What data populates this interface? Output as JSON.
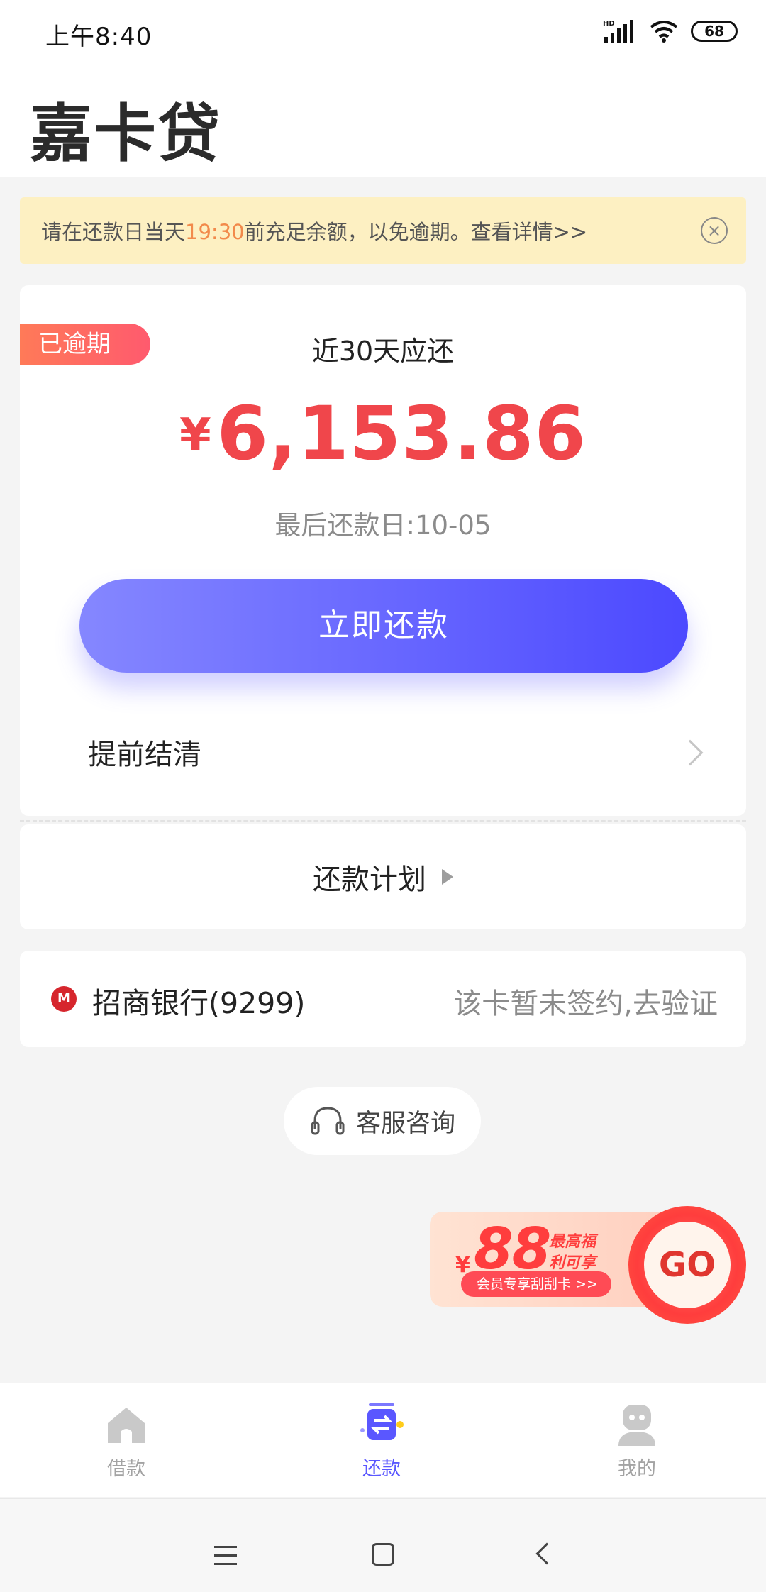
{
  "status_bar": {
    "time": "上午8:40",
    "network": "HD",
    "battery": "68"
  },
  "header": {
    "title": "嘉卡贷"
  },
  "notice": {
    "text_before": "请在还款日当天",
    "time_highlight": "19:30",
    "text_after": "前充足余额，以免逾期。查看详情>>",
    "close_symbol": "×"
  },
  "bill": {
    "badge": "已逾期",
    "label": "近30天应还",
    "currency": "¥",
    "amount": "6,153.86",
    "due_date": "最后还款日:10-05",
    "repay_button": "立即还款",
    "settle_label": "提前结清"
  },
  "plan": {
    "label": "还款计划"
  },
  "bank": {
    "logo_text": "M",
    "name": "招商银行(9299)",
    "status": "该卡暂未签约,去验证"
  },
  "service": {
    "label": "客服咨询"
  },
  "promo": {
    "currency": "¥",
    "amount": "88",
    "side_line1": "最高福",
    "side_line2": "利可享",
    "pill": "会员专享刮刮卡 >>",
    "go": "GO"
  },
  "tabs": [
    {
      "label": "借款",
      "icon": "home-icon",
      "active": false
    },
    {
      "label": "还款",
      "icon": "repay-icon",
      "active": true
    },
    {
      "label": "我的",
      "icon": "profile-icon",
      "active": false
    }
  ],
  "colors": {
    "accent": "#5a57ff",
    "amount": "#f0464b",
    "notice_bg": "#fdf0c2",
    "badge": "#ff6a60"
  }
}
